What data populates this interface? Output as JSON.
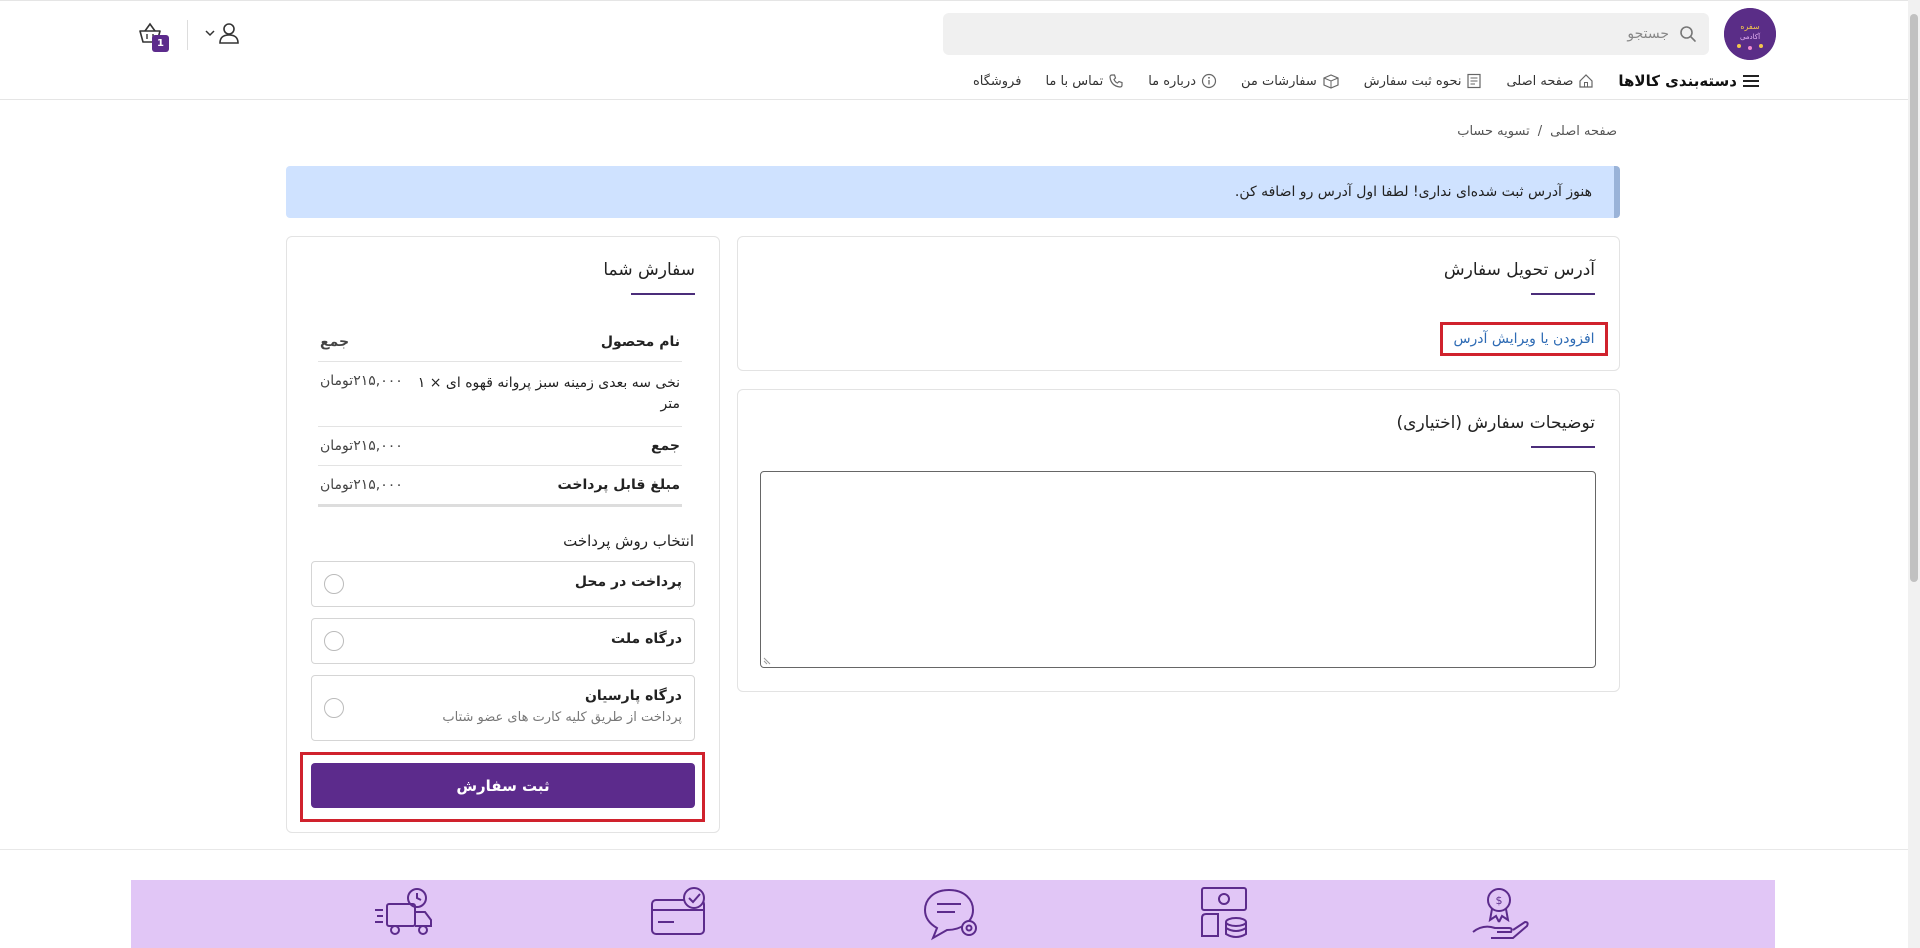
{
  "header": {
    "search_placeholder": "جستجو",
    "cart_count": "1",
    "logo_text": "آکادمی سفره"
  },
  "nav": {
    "categories": "دسته‌بندی کالاها",
    "items": [
      {
        "label": "صفحه اصلی",
        "icon": "home-icon"
      },
      {
        "label": "نحوه ثبت سفارش",
        "icon": "document-icon"
      },
      {
        "label": "سفارشات من",
        "icon": "box-icon"
      },
      {
        "label": "درباره ما",
        "icon": "info-icon"
      },
      {
        "label": "تماس با ما",
        "icon": "phone-icon"
      },
      {
        "label": "فروشگاه",
        "icon": ""
      }
    ]
  },
  "breadcrumb": {
    "home": "صفحه اصلی",
    "separator": "/",
    "current": "تسویه حساب"
  },
  "alert": {
    "message": "هنوز آدرس ثبت شده‌ای نداری! لطفا اول آدرس رو اضافه کن."
  },
  "address_card": {
    "title": "آدرس تحویل سفارش",
    "add_edit_link": "افزودن یا ویرایش آدرس"
  },
  "notes_card": {
    "title": "توضیحات سفارش (اختیاری)",
    "value": ""
  },
  "order": {
    "title": "سفارش شما",
    "col_product": "نام محصول",
    "col_total": "جمع",
    "item_name": "نخی سه بعدی زمینه سبز پروانه قهوه ای",
    "item_qty": "× ۱",
    "item_unit": "متر",
    "item_price": "۲۱۵,۰۰۰",
    "currency": "تومان",
    "subtotal_label": "جمع",
    "subtotal": "۲۱۵,۰۰۰",
    "payable_label": "مبلغ قابل پرداخت",
    "payable": "۲۱۵,۰۰۰"
  },
  "payment": {
    "title": "انتخاب روش پرداخت",
    "options": [
      {
        "label": "پرداخت در محل",
        "sub": ""
      },
      {
        "label": "درگاه ملت",
        "sub": ""
      },
      {
        "label": "درگاه پارسیان",
        "sub": "پرداخت از طریق کلیه کارت های عضو شتاب"
      }
    ],
    "submit": "ثبت سفارش"
  },
  "colors": {
    "brand": "#5c2b8c",
    "alert_bg": "#cfe2ff",
    "highlight": "#d0222d",
    "footer_band": "#e1c6f6"
  }
}
